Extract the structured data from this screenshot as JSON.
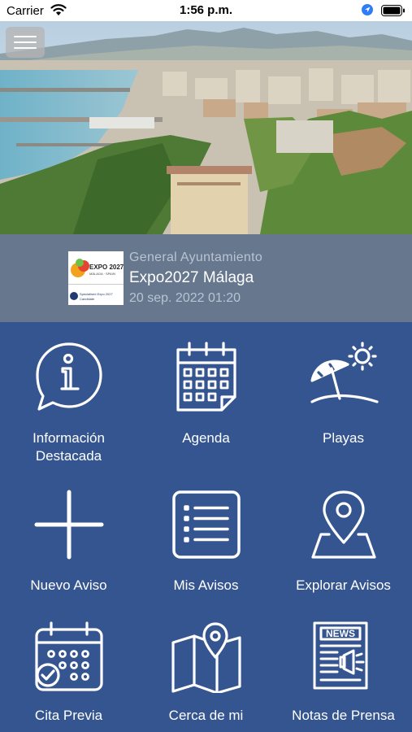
{
  "status_bar": {
    "carrier": "Carrier",
    "time": "1:56 p.m."
  },
  "header": {
    "menu_icon": "hamburger-menu-icon"
  },
  "news": {
    "category": "General Ayuntamiento",
    "title": "Expo2027 Málaga",
    "date": "20 sep. 2022 01:20",
    "thumb": {
      "line1": "EXPO 2027",
      "line2": "MÁLAGA · SPAIN",
      "line3": "Specialised Expo 2027",
      "line4": "Candidate"
    }
  },
  "menu": [
    {
      "id": "informacion-destacada",
      "icon": "info-speech-bubble-icon",
      "label_lines": [
        "Información",
        "Destacada"
      ]
    },
    {
      "id": "agenda",
      "icon": "calendar-icon",
      "label_lines": [
        "Agenda"
      ]
    },
    {
      "id": "playas",
      "icon": "beach-umbrella-icon",
      "label_lines": [
        "Playas"
      ]
    },
    {
      "id": "nuevo-aviso",
      "icon": "plus-icon",
      "label_lines": [
        "Nuevo Aviso"
      ]
    },
    {
      "id": "mis-avisos",
      "icon": "list-icon",
      "label_lines": [
        "Mis Avisos"
      ]
    },
    {
      "id": "explorar-avisos",
      "icon": "map-pin-icon",
      "label_lines": [
        "Explorar Avisos"
      ]
    },
    {
      "id": "cita-previa",
      "icon": "calendar-check-icon",
      "label_lines": [
        "Cita Previa"
      ]
    },
    {
      "id": "cerca-de-mi",
      "icon": "folded-map-pin-icon",
      "label_lines": [
        "Cerca de mi"
      ]
    },
    {
      "id": "notas-de-prensa",
      "icon": "newspaper-icon",
      "label_lines": [
        "Notas de Prensa"
      ]
    }
  ],
  "colors": {
    "background": "#34558f",
    "banner": "#66778e",
    "icon": "#ffffff"
  }
}
